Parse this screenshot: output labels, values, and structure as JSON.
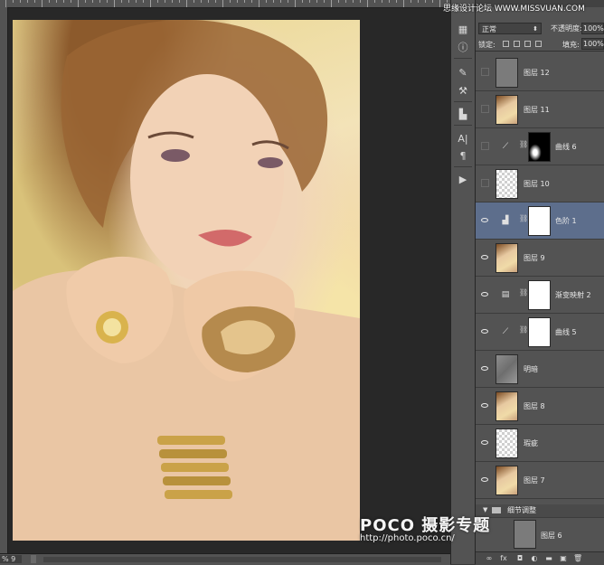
{
  "colors": {
    "canvas_bg": "#282828",
    "panel_bg": "#535353",
    "selected_layer": "#5d6e8c"
  },
  "status": {
    "zoom": "% 9"
  },
  "panel": {
    "blend_mode": "正常",
    "opacity_label": "不透明度:",
    "opacity_value": "100%",
    "lock_label": "锁定:",
    "fill_label": "填充:",
    "fill_value": "100%"
  },
  "layers": [
    {
      "name": "图层 12",
      "thumb": "gray",
      "visible": false
    },
    {
      "name": "图层 11",
      "thumb": "photo",
      "visible": false
    },
    {
      "name": "曲线 6",
      "thumb": "black",
      "visible": false,
      "adjustment": "curves-icon",
      "mask": true
    },
    {
      "name": "图层 10",
      "thumb": "checker",
      "visible": false
    },
    {
      "name": "色阶 1",
      "thumb": "white",
      "visible": true,
      "adjustment": "levels-icon",
      "mask": true,
      "selected": true
    },
    {
      "name": "图层 9",
      "thumb": "photo",
      "visible": true
    },
    {
      "name": "渐变映射 2",
      "thumb": "white",
      "visible": true,
      "adjustment": "gradient-map-icon",
      "mask": true
    },
    {
      "name": "曲线 5",
      "thumb": "white",
      "visible": true,
      "adjustment": "curves-icon",
      "mask": true
    },
    {
      "name": "明暗",
      "thumb": "texture",
      "visible": true
    },
    {
      "name": "图层 8",
      "thumb": "photo",
      "visible": true
    },
    {
      "name": "瑕疵",
      "thumb": "checker",
      "visible": true
    },
    {
      "name": "图层 7",
      "thumb": "photo",
      "visible": true
    }
  ],
  "group": {
    "name": "细节调整"
  },
  "group_child": {
    "name": "图层 6"
  },
  "watermark": {
    "top": "思缘设计论坛 WWW.MISSVUAN.COM",
    "logo": "POCO 摄影专题",
    "url": "http://photo.poco.cn/"
  },
  "icons": [
    "eye-icon",
    "link-icon",
    "curves-icon",
    "levels-icon",
    "gradient-map-icon",
    "folder-icon"
  ]
}
